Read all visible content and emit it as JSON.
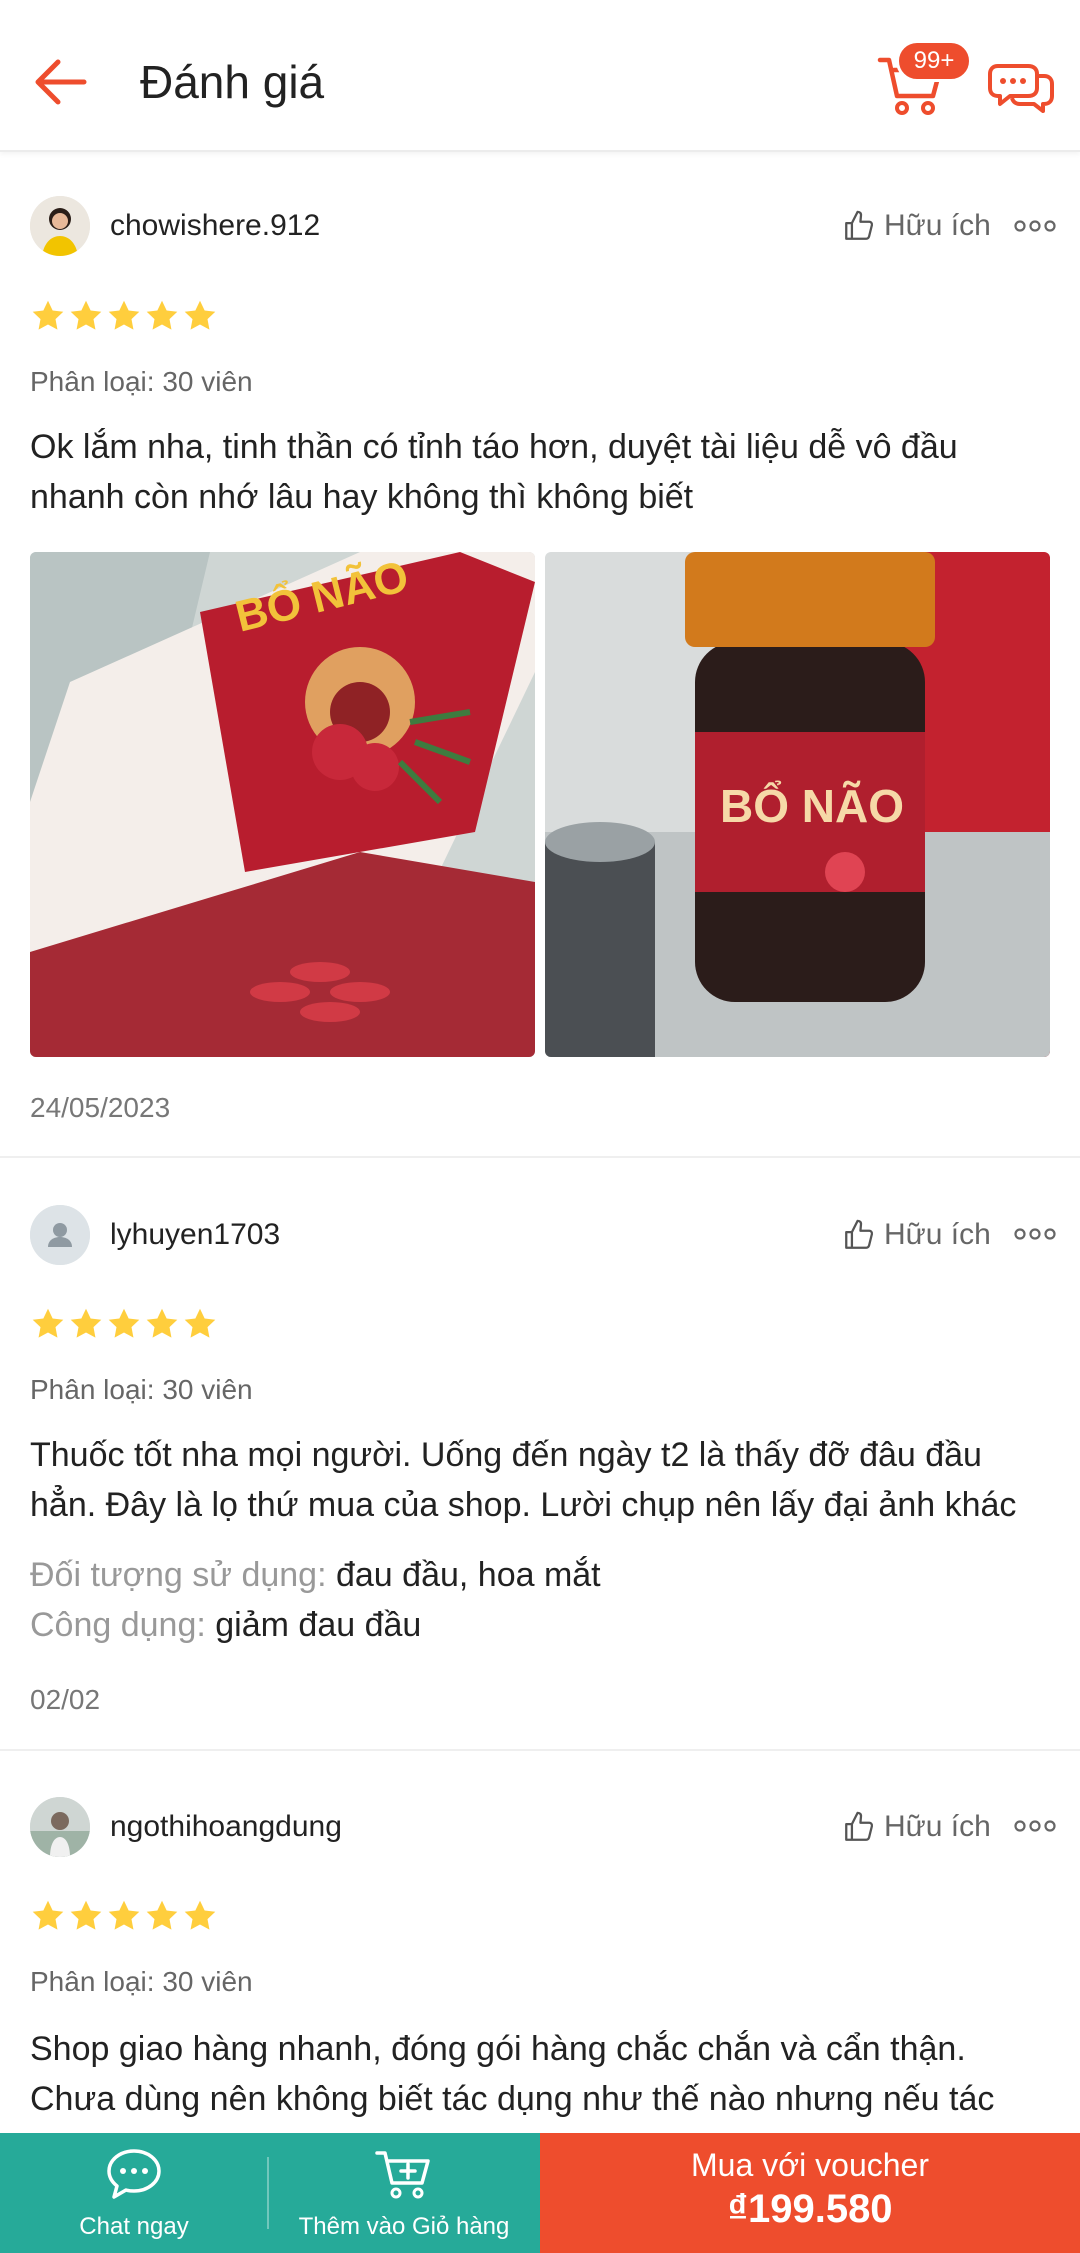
{
  "header": {
    "title": "Đánh giá",
    "cart_badge": "99+"
  },
  "colors": {
    "accent": "#ee4d2d",
    "star": "#ffce3d",
    "teal": "#26aa99"
  },
  "reviews": [
    {
      "username": "chowishere.912",
      "helpful_label": "Hữu ích",
      "rating": 5,
      "variant": "Phân loại: 30 viên",
      "text": "Ok lắm nha, tinh thần có tỉnh táo hơn, duyệt tài liệu dễ vô đầu nhanh còn nhớ lâu hay không thì không biết",
      "photos": [
        "product-box-photo",
        "product-bottle-photo"
      ],
      "date": "24/05/2023"
    },
    {
      "username": "lyhuyen1703",
      "helpful_label": "Hữu ích",
      "rating": 5,
      "variant": "Phân loại: 30 viên",
      "text": "Thuốc tốt nha mọi người. Uống đến ngày t2 là thấy đỡ đâu đầu hẳn. Đây là lọ thứ mua của shop. Lười chụp nên lấy đại ảnh khác",
      "attr1_key": "Đối tượng sử dụng:",
      "attr1_value": "đau đầu, hoa mắt",
      "attr2_key": "Công dụng:",
      "attr2_value": "giảm đau đầu",
      "date": "02/02"
    },
    {
      "username": "ngothihoangdung",
      "helpful_label": "Hữu ích",
      "rating": 5,
      "variant": "Phân loại: 30 viên",
      "text": "Shop giao hàng nhanh, đóng gói hàng chắc chắn và cẩn thận. Chưa dùng nên không biết tác dụng như thế nào nhưng nếu tác"
    }
  ],
  "bottom_bar": {
    "chat_label": "Chat ngay",
    "cart_label": "Thêm vào Giỏ hàng",
    "buy_label": "Mua với voucher",
    "buy_price": "₫199.580"
  }
}
